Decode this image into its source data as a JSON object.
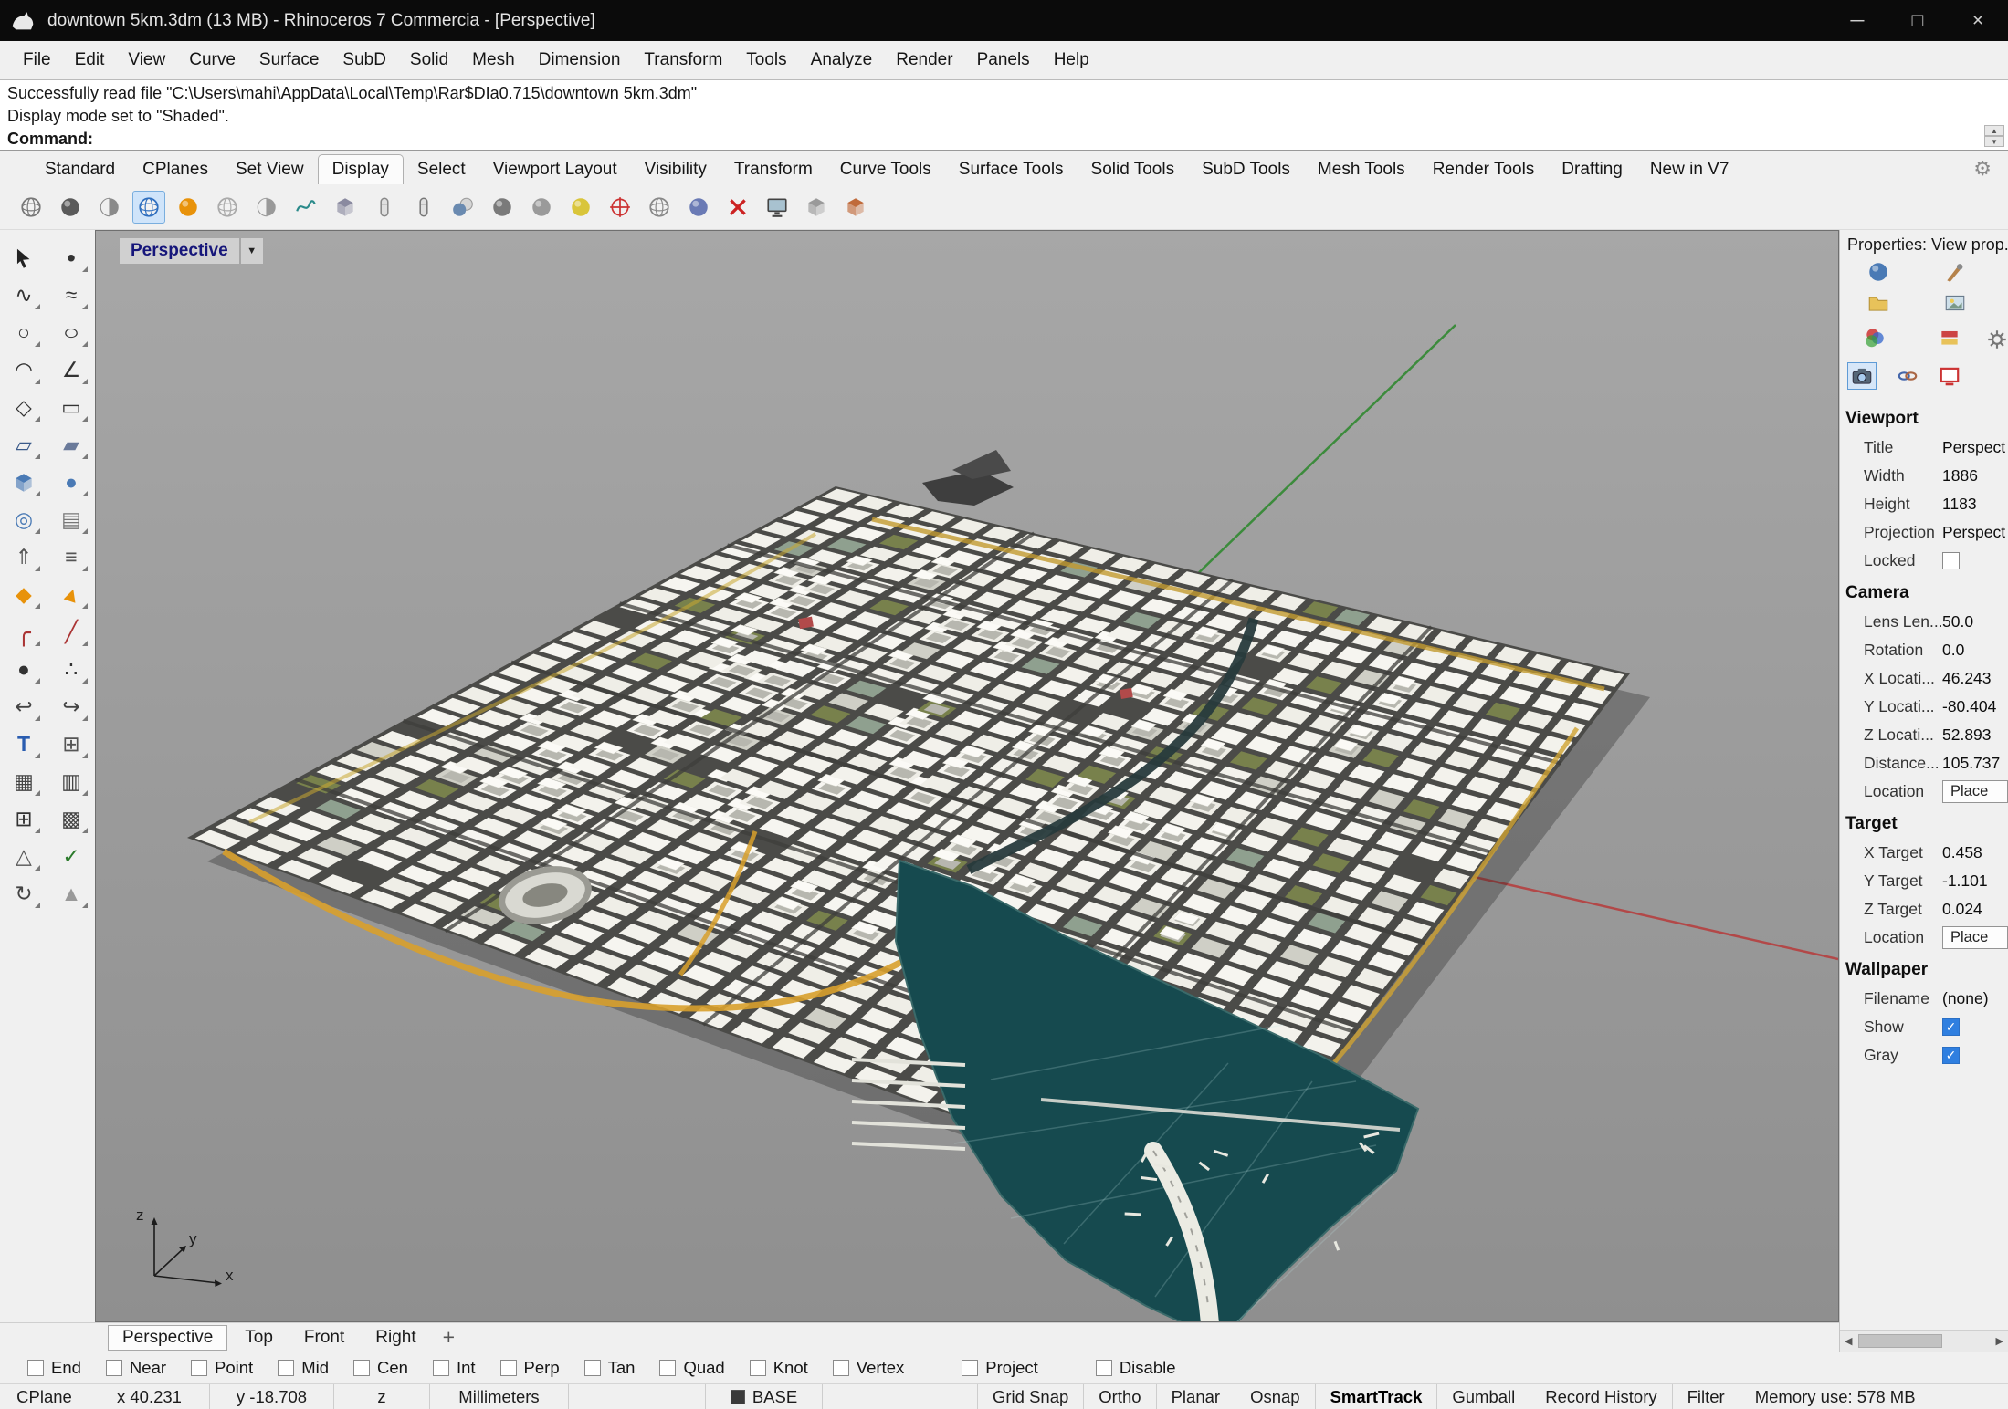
{
  "window": {
    "title": "downtown 5km.3dm (13 MB) - Rhinoceros 7 Commercia - [Perspective]",
    "controls": {
      "minimize": "─",
      "maximize": "□",
      "close": "×"
    }
  },
  "menu_bar": {
    "items": [
      "File",
      "Edit",
      "View",
      "Curve",
      "Surface",
      "SubD",
      "Solid",
      "Mesh",
      "Dimension",
      "Transform",
      "Tools",
      "Analyze",
      "Render",
      "Panels",
      "Help"
    ]
  },
  "command_area": {
    "history": [
      "Successfully read file \"C:\\Users\\mahi\\AppData\\Local\\Temp\\Rar$DIa0.715\\downtown 5km.3dm\"",
      "Display mode set to \"Shaded\"."
    ],
    "prompt_label": "Command:",
    "spinner_up": "▲",
    "spinner_down": "▼"
  },
  "toolbar_tabs": {
    "items": [
      "Standard",
      "CPlanes",
      "Set View",
      "Display",
      "Select",
      "Viewport Layout",
      "Visibility",
      "Transform",
      "Curve Tools",
      "Surface Tools",
      "Solid Tools",
      "SubD Tools",
      "Mesh Tools",
      "Render Tools",
      "Drafting",
      "New in V7"
    ],
    "active": "Display",
    "gear_glyph": "⚙"
  },
  "display_toolbar": {
    "icons": [
      {
        "name": "wireframe-display-icon",
        "kind": "globe",
        "color": "#777777"
      },
      {
        "name": "shaded-display-icon",
        "kind": "sphere",
        "color": "#5a5a5a"
      },
      {
        "name": "ghosted-display-icon",
        "kind": "half",
        "color": "#8a8a8a"
      },
      {
        "name": "shaded-mode-icon",
        "kind": "globe",
        "color": "#2f6fbf",
        "selected": true
      },
      {
        "name": "rendered-display-icon",
        "kind": "sphere",
        "color": "#e8920a"
      },
      {
        "name": "xray-display-icon",
        "kind": "globe",
        "color": "#aaaaaa"
      },
      {
        "name": "technical-display-icon",
        "kind": "half",
        "color": "#999999"
      },
      {
        "name": "curvature-graph-icon",
        "kind": "squig",
        "color": "#2a8a8a"
      },
      {
        "name": "flat-shade-icon",
        "kind": "cube",
        "color": "#8a8aa0"
      },
      {
        "name": "beaker-a-icon",
        "kind": "capsule",
        "color": "#888888"
      },
      {
        "name": "beaker-b-icon",
        "kind": "capsule",
        "color": "#777777"
      },
      {
        "name": "two-spheres-icon",
        "kind": "duo",
        "color": "#6a8ab0"
      },
      {
        "name": "shadow-sphere-icon",
        "kind": "sphere",
        "color": "#7a7a7a"
      },
      {
        "name": "gray-sphere-icon",
        "kind": "sphere",
        "color": "#9a9a9a"
      },
      {
        "name": "sun-sphere-icon",
        "kind": "sphere",
        "color": "#d9c53a"
      },
      {
        "name": "compass-target-icon",
        "kind": "target",
        "color": "#cc3333"
      },
      {
        "name": "eye-sphere-icon",
        "kind": "globe",
        "color": "#888888"
      },
      {
        "name": "arrow-sphere-icon",
        "kind": "sphere",
        "color": "#6a7ab5"
      },
      {
        "name": "clipping-x-icon",
        "kind": "xmark",
        "color": "#cc2222"
      },
      {
        "name": "screen-capture-icon",
        "kind": "monitor",
        "color": "#444444"
      },
      {
        "name": "wire-cube-icon",
        "kind": "cube",
        "color": "#9a9a9a"
      },
      {
        "name": "color-cube-icon",
        "kind": "cube",
        "color": "#c06a3a"
      }
    ]
  },
  "left_toolbar": {
    "icons": [
      {
        "name": "select-arrow-icon",
        "kind": "arrow",
        "fly": false
      },
      {
        "name": "point-tool-icon",
        "glyph": "•",
        "color": "#333333",
        "fs": 28,
        "fly": true
      },
      {
        "name": "control-point-curve-icon",
        "glyph": "∿",
        "color": "#333333",
        "fly": true
      },
      {
        "name": "freeform-curve-icon",
        "glyph": "≈",
        "color": "#333333",
        "fly": true
      },
      {
        "name": "circle-tool-icon",
        "glyph": "○",
        "color": "#333333",
        "fly": true
      },
      {
        "name": "ellipse-tool-icon",
        "glyph": "○",
        "color": "#333333",
        "sx": 1.35,
        "fly": true
      },
      {
        "name": "arc-tool-icon",
        "glyph": "◠",
        "color": "#333333",
        "fly": true
      },
      {
        "name": "polyline-tool-icon",
        "glyph": "∠",
        "color": "#333333",
        "fly": true
      },
      {
        "name": "polygon-tool-icon",
        "glyph": "◇",
        "color": "#333333",
        "fly": true
      },
      {
        "name": "rectangle-tool-icon",
        "glyph": "▭",
        "color": "#333333",
        "fly": true
      },
      {
        "name": "surface-tool-icon",
        "glyph": "▱",
        "color": "#3a5a8a",
        "fly": true
      },
      {
        "name": "loft-tool-icon",
        "glyph": "▰",
        "color": "#6a7a9a",
        "fly": true
      },
      {
        "name": "box-tool-icon",
        "kind": "cube",
        "color": "#4a7ab5",
        "fly": true
      },
      {
        "name": "sphere-tool-icon",
        "glyph": "●",
        "color": "#4a7ab5",
        "fly": true
      },
      {
        "name": "cylinder-tool-icon",
        "glyph": "◎",
        "color": "#4a7ab5",
        "fly": true
      },
      {
        "name": "plane-tool-icon",
        "glyph": "▤",
        "color": "#777777",
        "fly": true
      },
      {
        "name": "extrude-tool-icon",
        "glyph": "⇑",
        "color": "#555555",
        "fly": true
      },
      {
        "name": "sweep-tool-icon",
        "glyph": "≡",
        "color": "#555555",
        "fly": true
      },
      {
        "name": "gem-tool-icon",
        "glyph": "◆",
        "color": "#e8920a",
        "fly": true
      },
      {
        "name": "bend-tool-icon",
        "glyph": "▲",
        "color": "#e8920a",
        "rot": 18,
        "fly": true
      },
      {
        "name": "fillet-tool-icon",
        "glyph": "╭",
        "color": "#aa3333",
        "fs": 26,
        "fly": true
      },
      {
        "name": "chamfer-tool-icon",
        "glyph": "╱",
        "color": "#aa3333",
        "fly": true
      },
      {
        "name": "dark-sphere-icon",
        "glyph": "●",
        "color": "#333333",
        "fly": true
      },
      {
        "name": "point-cloud-icon",
        "glyph": "∴",
        "color": "#333333",
        "fly": true
      },
      {
        "name": "hook-left-icon",
        "glyph": "↩",
        "color": "#444444",
        "fly": true
      },
      {
        "name": "hook-right-icon",
        "glyph": "↪",
        "color": "#444444",
        "fly": true
      },
      {
        "name": "text-tool-icon",
        "glyph": "T",
        "color": "#2a5db0",
        "bold": true,
        "fly": true
      },
      {
        "name": "gumball-icon",
        "glyph": "⊞",
        "color": "#555555",
        "fly": true
      },
      {
        "name": "array-tool-icon",
        "glyph": "▦",
        "color": "#444444",
        "fly": true
      },
      {
        "name": "mirror-tool-icon",
        "glyph": "▥",
        "color": "#444444",
        "fly": true
      },
      {
        "name": "grid-tool-icon",
        "glyph": "⊞",
        "color": "#333333",
        "fly": true
      },
      {
        "name": "hatch-tool-icon",
        "glyph": "▩",
        "color": "#444444",
        "fly": true
      },
      {
        "name": "unroll-tool-icon",
        "glyph": "△",
        "color": "#555555",
        "fly": true
      },
      {
        "name": "check-tool-icon",
        "glyph": "✓",
        "color": "#2a7a2a",
        "fly": false
      },
      {
        "name": "rotate-tool-icon",
        "glyph": "↻",
        "color": "#444444",
        "fly": true
      },
      {
        "name": "wedge-tool-icon",
        "glyph": "▲",
        "color": "#999999",
        "fly": true
      }
    ]
  },
  "viewport": {
    "active_label": "Perspective",
    "dropdown_glyph": "▼",
    "tabs": [
      "Perspective",
      "Top",
      "Front",
      "Right"
    ],
    "active_tab": "Perspective",
    "pan_glyph": "+",
    "axis_labels": {
      "x": "x",
      "y": "y",
      "z": "z"
    }
  },
  "properties_panel": {
    "title": "Properties: View prop...",
    "check_glyph": "✓",
    "scroll_left": "◀",
    "scroll_right": "▶",
    "icons": [
      {
        "name": "properties-object-icon",
        "kind": "sphere",
        "color": "#4a7ab5"
      },
      {
        "name": "material-brush-icon",
        "kind": "brush",
        "color": "#b5824a"
      },
      {
        "name": "folder-icon",
        "kind": "folder",
        "color": "#e8c25a"
      },
      {
        "name": "texture-photo-icon",
        "kind": "photo",
        "color": "#7a99aa"
      },
      {
        "name": "display-rgb-icon",
        "kind": "rgb",
        "color": "#cc3333"
      },
      {
        "name": "layers-stack-icon",
        "kind": "layers",
        "color": "#cc4444"
      },
      {
        "name": "panel-gear-icon",
        "kind": "gear",
        "color": "#777777"
      },
      {
        "name": "camera-icon",
        "kind": "camera",
        "color": "#556677",
        "selected": true
      },
      {
        "name": "link-chain-icon",
        "kind": "link",
        "color": "#4466aa"
      },
      {
        "name": "monitor-frame-icon",
        "kind": "monitor-red",
        "color": "#cc3333"
      }
    ],
    "sections": [
      {
        "header": "Viewport",
        "rows": [
          {
            "label": "Title",
            "value": "Perspect"
          },
          {
            "label": "Width",
            "value": "1886"
          },
          {
            "label": "Height",
            "value": "1183"
          },
          {
            "label": "Projection",
            "value": "Perspect"
          },
          {
            "label": "Locked",
            "value": "",
            "type": "checkbox",
            "checked": false
          }
        ]
      },
      {
        "header": "Camera",
        "rows": [
          {
            "label": "Lens Len...",
            "value": "50.0"
          },
          {
            "label": "Rotation",
            "value": "0.0"
          },
          {
            "label": "X Locati...",
            "value": "46.243"
          },
          {
            "label": "Y Locati...",
            "value": "-80.404"
          },
          {
            "label": "Z Locati...",
            "value": "52.893"
          },
          {
            "label": "Distance...",
            "value": "105.737"
          },
          {
            "label": "Location",
            "value": "Place",
            "type": "button"
          }
        ]
      },
      {
        "header": "Target",
        "rows": [
          {
            "label": "X Target",
            "value": "0.458"
          },
          {
            "label": "Y Target",
            "value": "-1.101"
          },
          {
            "label": "Z Target",
            "value": "0.024"
          },
          {
            "label": "Location",
            "value": "Place",
            "type": "button"
          }
        ]
      },
      {
        "header": "Wallpaper",
        "rows": [
          {
            "label": "Filename",
            "value": "(none)"
          },
          {
            "label": "Show",
            "value": "",
            "type": "checkbox",
            "checked": true
          },
          {
            "label": "Gray",
            "value": "",
            "type": "checkbox",
            "checked": true
          }
        ]
      }
    ]
  },
  "osnap_bar": {
    "items": [
      {
        "label": "End",
        "checked": false
      },
      {
        "label": "Near",
        "checked": false
      },
      {
        "label": "Point",
        "checked": false
      },
      {
        "label": "Mid",
        "checked": false
      },
      {
        "label": "Cen",
        "checked": false
      },
      {
        "label": "Int",
        "checked": false
      },
      {
        "label": "Perp",
        "checked": false
      },
      {
        "label": "Tan",
        "checked": false
      },
      {
        "label": "Quad",
        "checked": false
      },
      {
        "label": "Knot",
        "checked": false
      },
      {
        "label": "Vertex",
        "checked": false
      },
      {
        "label": "Project",
        "checked": false,
        "gap": true
      },
      {
        "label": "Disable",
        "checked": false,
        "gap": true
      }
    ]
  },
  "status_bar": {
    "swatch_color": "#3a3a3a",
    "items": [
      {
        "label": "CPlane"
      },
      {
        "label": "x 40.231"
      },
      {
        "label": "y -18.708"
      },
      {
        "label": "z"
      },
      {
        "label": "Millimeters"
      },
      {
        "label": "BASE",
        "swatch": true,
        "spacer": 150
      },
      {
        "label": "Grid Snap",
        "spacer": 170
      },
      {
        "label": "Ortho"
      },
      {
        "label": "Planar"
      },
      {
        "label": "Osnap"
      },
      {
        "label": "SmartTrack",
        "bold": true
      },
      {
        "label": "Gumball"
      },
      {
        "label": "Record History"
      },
      {
        "label": "Filter"
      },
      {
        "label": "Memory use: 578 MB",
        "mem": true
      }
    ]
  }
}
